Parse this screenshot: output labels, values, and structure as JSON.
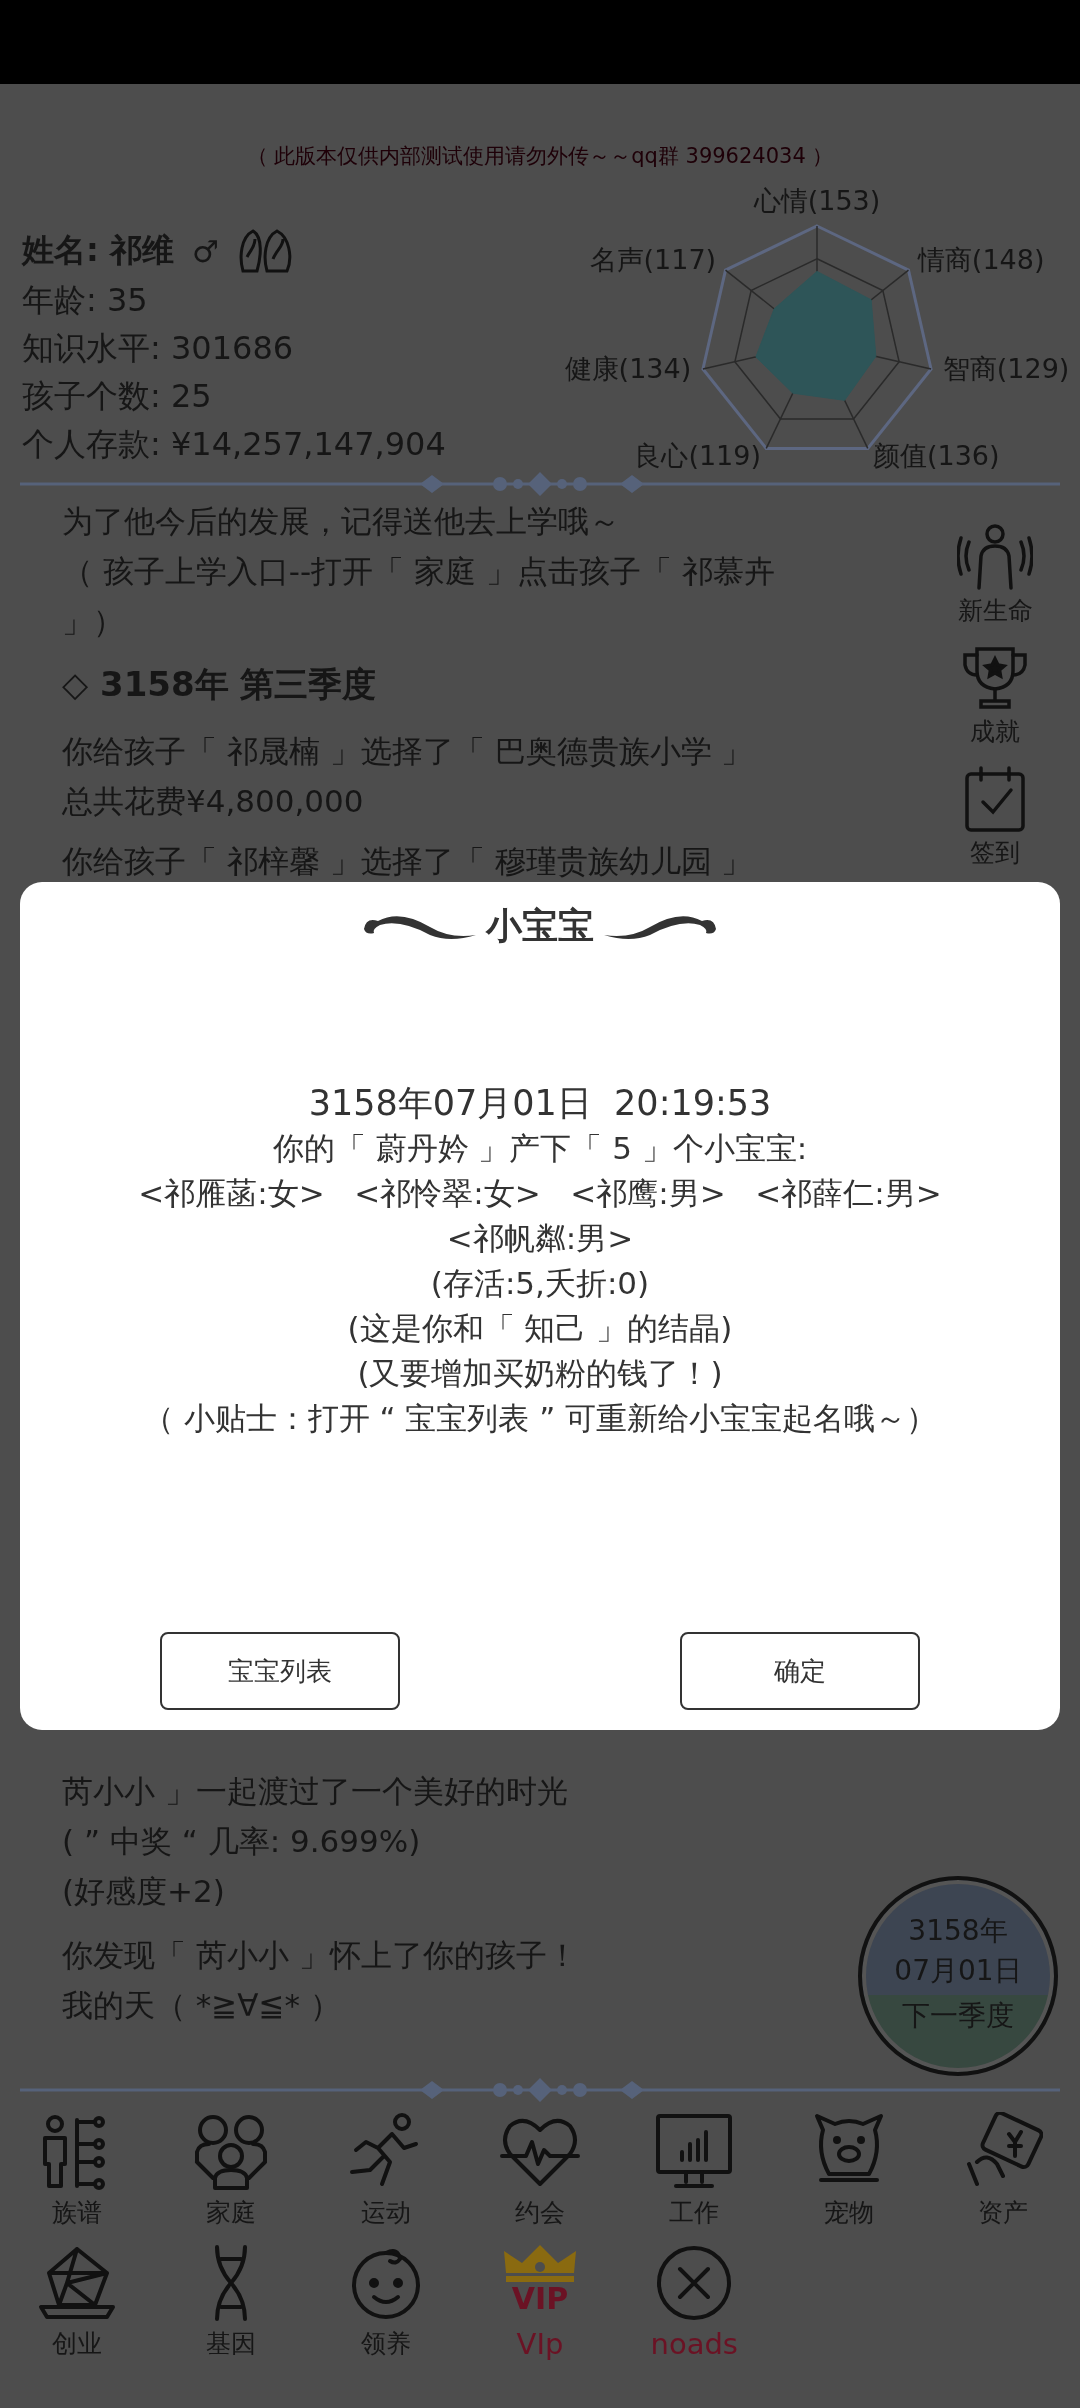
{
  "notice": "（ 此版本仅供内部测试使用请勿外传～～qq群 399624034 ）",
  "profile": {
    "name": "姓名: 祁维",
    "gender_symbol": "♂",
    "lines": [
      "年龄: 35",
      "知识水平: 301686",
      "孩子个数: 25",
      "个人存款: ¥14,257,147,904"
    ]
  },
  "attributes": [
    {
      "label": "心情",
      "value": "(153)"
    },
    {
      "label": "名声",
      "value": "(117)"
    },
    {
      "label": "情商",
      "value": "(148)"
    },
    {
      "label": "健康",
      "value": "(134)"
    },
    {
      "label": "智商",
      "value": "(129)"
    },
    {
      "label": "良心",
      "value": "(119)"
    },
    {
      "label": "颜值",
      "value": "(136)"
    }
  ],
  "log_top": [
    {
      "kind": "text",
      "lines": [
        "为了他今后的发展，记得送他去上学哦～",
        "（ 孩子上学入口--打开「 家庭 」点击孩子「 祁慕卉",
        " 」）"
      ]
    },
    {
      "kind": "heading",
      "lines": [
        "◇  3158年 第三季度"
      ]
    },
    {
      "kind": "text",
      "lines": [
        "你给孩子「 祁晟楠 」选择了「 巴奥德贵族小学 」",
        "总共花费¥4,800,000"
      ]
    },
    {
      "kind": "text",
      "lines": [
        "你给孩子「 祁梓馨 」选择了「 穆瑾贵族幼儿园 」"
      ]
    }
  ],
  "side_actions": [
    {
      "label": "新生命"
    },
    {
      "label": "成就"
    },
    {
      "label": "签到"
    }
  ],
  "log_bottom": [
    {
      "lines": [
        "芮小小 」一起渡过了一个美好的时光",
        "( ” 中奖 “ 几率: 9.699%)",
        "(好感度+2)"
      ]
    },
    {
      "lines": [
        "你发现「 芮小小 」怀上了你的孩子！",
        "我的天（ *≧∀≦* ）"
      ]
    }
  ],
  "next_button": {
    "lines": [
      "3158年",
      "07月01日",
      "下一季度"
    ]
  },
  "nav": [
    {
      "label": "族谱",
      "accent": false
    },
    {
      "label": "家庭",
      "accent": false
    },
    {
      "label": "运动",
      "accent": false
    },
    {
      "label": "约会",
      "accent": false
    },
    {
      "label": "工作",
      "accent": false
    },
    {
      "label": "宠物",
      "accent": false
    },
    {
      "label": "资产",
      "accent": false
    },
    {
      "label": "创业",
      "accent": false
    },
    {
      "label": "基因",
      "accent": false
    },
    {
      "label": "领养",
      "accent": false
    },
    {
      "label": "VIp",
      "accent": true,
      "badge": "VIP"
    },
    {
      "label": "noads",
      "accent": true
    }
  ],
  "dialog": {
    "title": "小宝宝",
    "lines": [
      "3158年07月01日  20:19:53",
      "你的「 蔚丹妗 」产下「 5 」个小宝宝:",
      "<祁雁菡:女>   <祁怜翠:女>   <祁鹰:男>   <祁薛仁:男>",
      "<祁帆粼:男>",
      "(存活:5,夭折:0)",
      "(这是你和「 知己 」的结晶)",
      "(又要增加买奶粉的钱了！)",
      "（ 小贴士：打开 “ 宝宝列表 ” 可重新给小宝宝起名哦～）"
    ],
    "buttons": [
      "宝宝列表",
      "确定"
    ]
  }
}
